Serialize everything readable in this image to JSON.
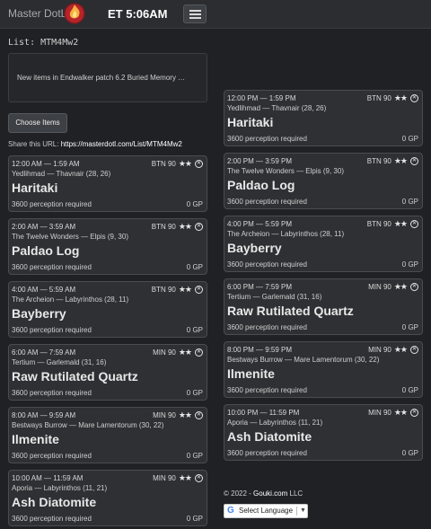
{
  "header": {
    "brand": "Master DotL",
    "clock": "ET 5:06AM"
  },
  "list": {
    "label": "List: MTM4Mw2",
    "description": "New items in Endwalker patch 6.2 Buried Memory …",
    "choose_label": "Choose Items",
    "share_prefix": "Share this URL:",
    "share_url": "https://masterdotl.com/List/MTM4Mw2"
  },
  "icons": {
    "logo": "flame-logo-icon",
    "menu": "hamburger-menu-icon",
    "stars": "stars-icon",
    "remove": "circle-x-icon",
    "google": "google-g-icon"
  },
  "colors": {
    "background": "#1f2124",
    "card": "#2e3033",
    "card_border": "#4a4c50"
  },
  "cards": [
    {
      "time": "12:00 AM — 1:59 AM",
      "job": "BTN 90",
      "stars": "★★",
      "location": "Yedlihmad — Thavnair (28, 26)",
      "name": "Haritaki",
      "requirement": "3600 perception required",
      "price": "0 GP"
    },
    {
      "time": "2:00 AM — 3:59 AM",
      "job": "BTN 90",
      "stars": "★★",
      "location": "The Twelve Wonders — Elpis (9, 30)",
      "name": "Paldao Log",
      "requirement": "3600 perception required",
      "price": "0 GP"
    },
    {
      "time": "4:00 AM — 5:59 AM",
      "job": "BTN 90",
      "stars": "★★",
      "location": "The Archeion — Labyrinthos (28, 11)",
      "name": "Bayberry",
      "requirement": "3600 perception required",
      "price": "0 GP"
    },
    {
      "time": "6:00 AM — 7:59 AM",
      "job": "MIN 90",
      "stars": "★★",
      "location": "Tertium — Garlemald (31, 16)",
      "name": "Raw Rutilated Quartz",
      "requirement": "3600 perception required",
      "price": "0 GP"
    },
    {
      "time": "8:00 AM — 9:59 AM",
      "job": "MIN 90",
      "stars": "★★",
      "location": "Bestways Burrow — Mare Lamentorum (30, 22)",
      "name": "Ilmenite",
      "requirement": "3600 perception required",
      "price": "0 GP"
    },
    {
      "time": "10:00 AM — 11:59 AM",
      "job": "MIN 90",
      "stars": "★★",
      "location": "Aporia — Labyrinthos (11, 21)",
      "name": "Ash Diatomite",
      "requirement": "3600 perception required",
      "price": "0 GP"
    },
    {
      "time": "12:00 PM — 1:59 PM",
      "job": "BTN 90",
      "stars": "★★",
      "location": "Yedlihmad — Thavnair (28, 26)",
      "name": "Haritaki",
      "requirement": "3600 perception required",
      "price": "0 GP"
    },
    {
      "time": "2:00 PM — 3:59 PM",
      "job": "BTN 90",
      "stars": "★★",
      "location": "The Twelve Wonders — Elpis (9, 30)",
      "name": "Paldao Log",
      "requirement": "3600 perception required",
      "price": "0 GP"
    },
    {
      "time": "4:00 PM — 5:59 PM",
      "job": "BTN 90",
      "stars": "★★",
      "location": "The Archeion — Labyrinthos (28, 11)",
      "name": "Bayberry",
      "requirement": "3600 perception required",
      "price": "0 GP"
    },
    {
      "time": "6:00 PM — 7:59 PM",
      "job": "MIN 90",
      "stars": "★★",
      "location": "Tertium — Garlemald (31, 16)",
      "name": "Raw Rutilated Quartz",
      "requirement": "3600 perception required",
      "price": "0 GP"
    },
    {
      "time": "8:00 PM — 9:59 PM",
      "job": "MIN 90",
      "stars": "★★",
      "location": "Bestways Burrow — Mare Lamentorum (30, 22)",
      "name": "Ilmenite",
      "requirement": "3600 perception required",
      "price": "0 GP"
    },
    {
      "time": "10:00 PM — 11:59 PM",
      "job": "MIN 90",
      "stars": "★★",
      "location": "Aporia — Labyrinthos (11, 21)",
      "name": "Ash Diatomite",
      "requirement": "3600 perception required",
      "price": "0 GP"
    }
  ],
  "footer": {
    "copyright": "© 2022 -",
    "company": "Gouki.com",
    "suffix": "LLC",
    "translate_label": "Select Language",
    "translate_arrow": "▼"
  }
}
